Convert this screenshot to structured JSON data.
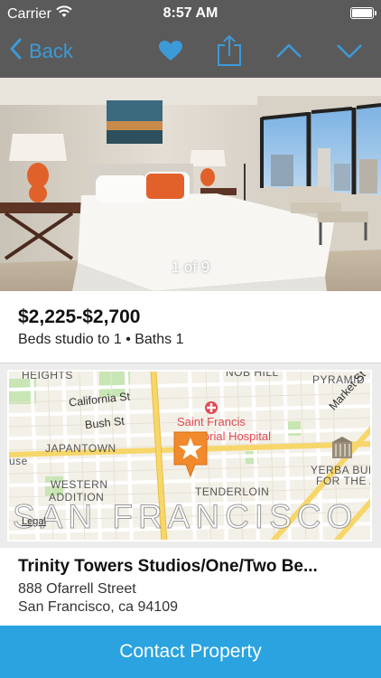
{
  "status_bar": {
    "carrier": "Carrier",
    "time": "8:57 AM",
    "battery_level": 1.0
  },
  "nav": {
    "back_label": "Back",
    "icons": [
      "chevron-left-icon",
      "heart-icon",
      "share-icon",
      "chevron-up-icon",
      "chevron-down-icon"
    ],
    "accent_color": "#3d9ad9"
  },
  "photo": {
    "counter": "1 of 9"
  },
  "listing": {
    "price": "$2,225-$2,700",
    "specs": "Beds studio to 1 • Baths 1"
  },
  "map": {
    "area_labels": [
      "HEIGHTS",
      "NOB HILL",
      "PYRAMID",
      "JAPANTOWN",
      "WESTERN",
      "ADDITION",
      "TENDERLOIN",
      "YERBA BUENA CE",
      "FOR THE ART"
    ],
    "streets": [
      "California St",
      "Bush St",
      "Market St"
    ],
    "poi": [
      "Saint Francis",
      "Memorial Hospital"
    ],
    "city": "SAN FRANCISCO",
    "partial": "use",
    "legal": "Legal",
    "pin_color": "#f08a2c"
  },
  "property": {
    "name": "Trinity Towers Studios/One/Two Be...",
    "address_line1": "888 Ofarrell Street",
    "address_line2": "San Francisco, ca 94109"
  },
  "cta": {
    "label": "Contact Property",
    "color": "#2aa3e0"
  }
}
